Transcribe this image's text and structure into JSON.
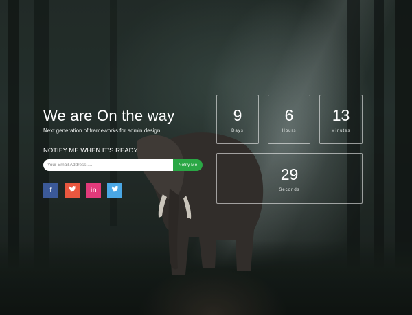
{
  "hero": {
    "title": "We are On the way",
    "subtitle": "Next generation of frameworks for admin design"
  },
  "notify": {
    "title": "NOTIFY ME WHEN IT'S READY",
    "email_placeholder": "Your Email Address......",
    "button_label": "Notify Me"
  },
  "social": [
    {
      "name": "facebook-icon",
      "glyph": "f",
      "color": "#3b5998"
    },
    {
      "name": "twitter-icon",
      "color": "#e9573f"
    },
    {
      "name": "linkedin-icon",
      "glyph": "in",
      "color": "#e23a7a"
    },
    {
      "name": "twitter-icon",
      "color": "#4aa7e5"
    }
  ],
  "countdown": {
    "days": {
      "value": "9",
      "label": "Days"
    },
    "hours": {
      "value": "6",
      "label": "Hours"
    },
    "minutes": {
      "value": "13",
      "label": "Minutes"
    },
    "seconds": {
      "value": "29",
      "label": "Seconds"
    }
  }
}
